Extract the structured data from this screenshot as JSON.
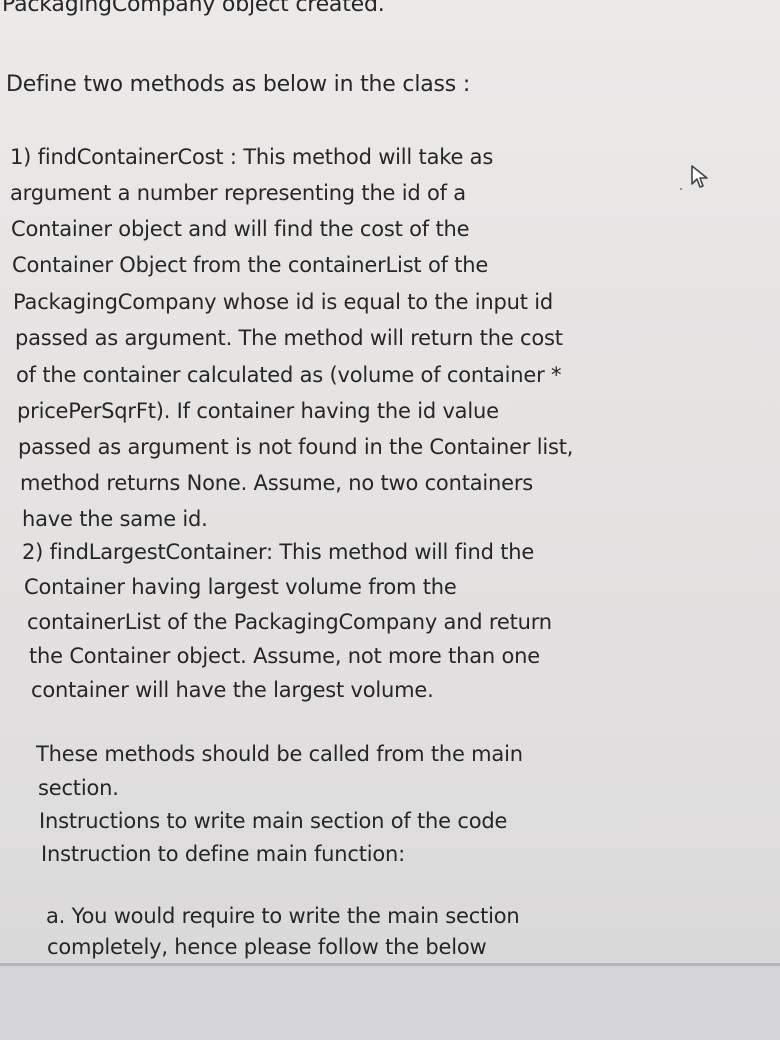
{
  "document": {
    "title_line": "PackagingCompany object created.",
    "heading": "Define two methods as below in the class :",
    "method1_lines": [
      "1) findContainerCost : This method will take as",
      "argument a number representing the id of a",
      "Container object and will find the cost of the",
      "Container Object from the containerList of the",
      "PackagingCompany whose id is equal to the input id",
      "passed as argument. The method will return the cost",
      "of the container calculated as (volume of container *",
      "pricePerSqrFt). If container having the id value",
      "passed as argument is not found in the Container list,",
      "method returns None. Assume, no two containers",
      "have the same id."
    ],
    "method2_lines": [
      "2) findLargestContainer: This method will find the",
      "Container having largest volume from the",
      "containerList of the PackagingCompany and return",
      "the Container object. Assume, not more than one",
      "container will have the largest volume."
    ],
    "main_lines": [
      "These methods should be called from the main",
      "section.",
      "Instructions to write main section of the code",
      "Instruction to define main function:"
    ],
    "step_a_lines": [
      "a. You would require to write the main section",
      "completely, hence please follow the below"
    ]
  },
  "icons": {
    "cursor": "mouse-pointer-icon"
  }
}
